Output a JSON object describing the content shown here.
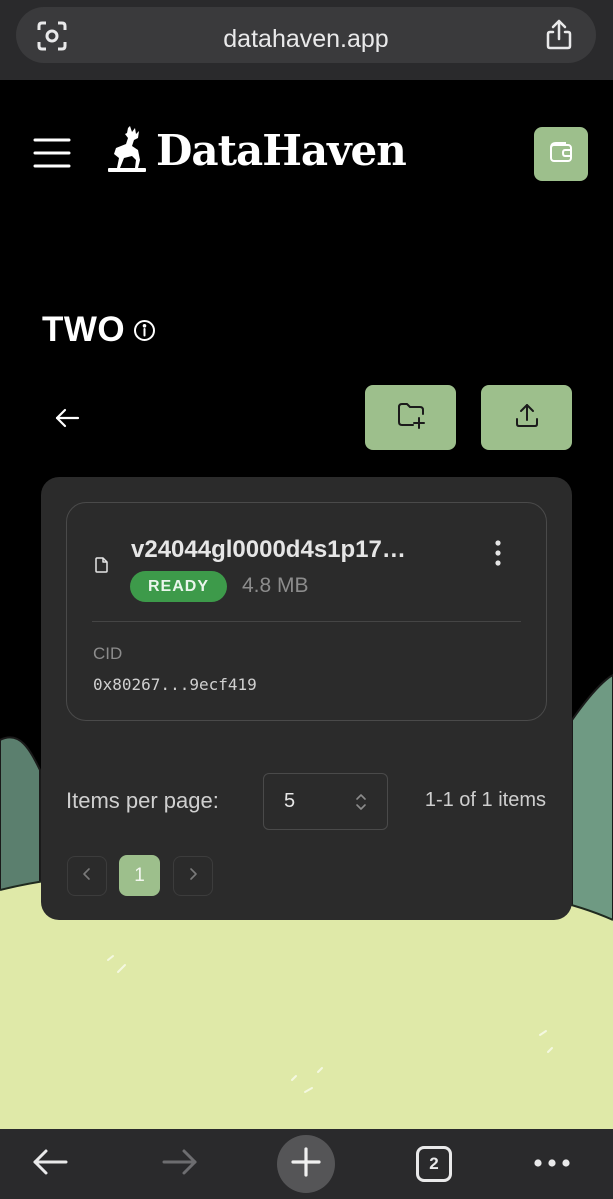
{
  "browser": {
    "url": "datahaven.app",
    "tab_count": "2",
    "icons": [
      "camera-search-icon",
      "share-icon",
      "back-arrow-icon",
      "forward-arrow-icon",
      "plus-icon",
      "more-dots-icon"
    ]
  },
  "header": {
    "brand": "DataHaven",
    "icons": [
      "hamburger-menu-icon",
      "deer-logo-icon",
      "wallet-icon"
    ]
  },
  "bucket": {
    "name": "TWO"
  },
  "files": [
    {
      "name": "v24044gl0000d4s1p17…",
      "status": "READY",
      "size": "4.8 MB",
      "cid_label": "CID",
      "cid": "0x80267...9ecf419"
    }
  ],
  "pagination": {
    "items_per_page_label": "Items per page:",
    "items_per_page_value": "5",
    "range": "1-1 of 1 items",
    "current_page": "1"
  },
  "colors": {
    "accent": "#9dbf8c",
    "ready": "#3d9a4a",
    "panel": "#2b2b2b",
    "background": "#000000"
  }
}
